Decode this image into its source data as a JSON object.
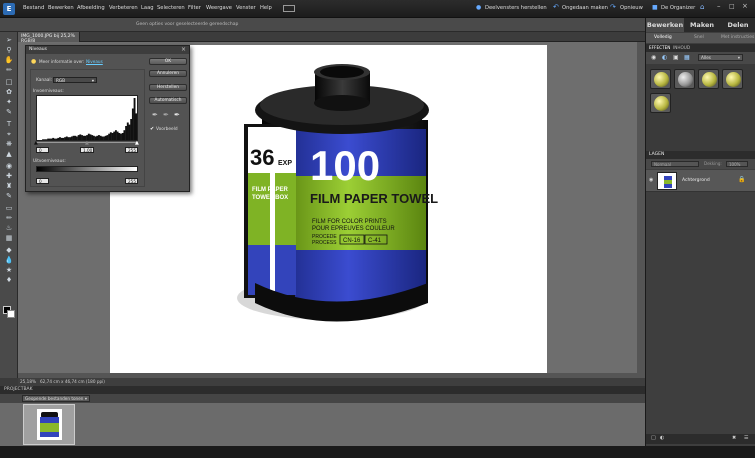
{
  "menubar": {
    "items": [
      "Bestand",
      "Bewerken",
      "Afbeelding",
      "Verbeteren",
      "Laag",
      "Selecteren",
      "Filter",
      "Weergave",
      "Venster",
      "Help"
    ],
    "undo_label": "Deelvensters herstellen",
    "create_label": "Ongedaan maken",
    "share_label": "Opnieuw",
    "organizer_label": "De Organizer"
  },
  "options_bar": {
    "hint": "Geen opties voor geselecteerde gereedschap"
  },
  "doc_tab": {
    "label": "IMG_1000.JPG bij 25,2% RGB/8"
  },
  "dialog": {
    "title": "Niveaus",
    "learn_more": "Meer informatie over:",
    "learn_link": "Niveaus",
    "channel_label": "Kanaal:",
    "channel_value": "RGB",
    "input_label": "Invoerniveaus:",
    "input_low": "0",
    "input_mid": "1,00",
    "input_high": "255",
    "output_label": "Uitvoerniveaus:",
    "output_low": "0",
    "output_high": "255",
    "ok": "OK",
    "cancel": "Annuleren",
    "reset": "Herstellen",
    "auto": "Automatisch",
    "preview": "Voorbeeld"
  },
  "status": {
    "zoom": "25,18%",
    "size": "62,74 cm x 46,74 cm (180 ppi)"
  },
  "project_bin": {
    "header": "PROJECTBAK",
    "dropdown": "Geopende bestanden tonen"
  },
  "right_panel": {
    "tabs": [
      "Bewerken",
      "Maken",
      "Delen"
    ],
    "subtabs": [
      "Volledig",
      "Snel",
      "Met instructies"
    ],
    "effects_tab": "EFFECTEN",
    "effects_tab2": "INHOUD",
    "effects_dropdown": "Alles",
    "layers_header": "LAGEN",
    "blend_mode": "Normaal",
    "opacity_label": "Dekking:",
    "opacity_value": "100%",
    "layer_name": "Achtergrond"
  },
  "histogram": [
    0,
    0,
    0,
    1,
    1,
    1,
    2,
    2,
    2,
    3,
    2,
    2,
    3,
    4,
    3,
    3,
    4,
    5,
    4,
    4,
    5,
    6,
    6,
    5,
    7,
    8,
    7,
    6,
    6,
    7,
    9,
    8,
    7,
    6,
    5,
    6,
    7,
    6,
    5,
    5,
    6,
    7,
    9,
    11,
    10,
    12,
    14,
    12,
    10,
    9,
    10,
    14,
    20,
    25,
    22,
    30,
    45,
    60,
    38
  ],
  "photo": {
    "big_number": "100",
    "exp_number": "36",
    "exp_suffix": "EXP",
    "brand": "FILM PAPER TOWEL",
    "side1": "FILM PAPER",
    "side2": "TOWEL BOX",
    "line1": "FILM FOR COLOR PRINTS",
    "line2": "POUR EPREUVES COULEUR",
    "line3": "PROCEDE",
    "line4": "PROCESS",
    "code1": "CN-16",
    "code2": "C-41"
  },
  "colors": {
    "blue": "#2f3fb8",
    "green": "#8ab82a",
    "accent": "#0c82d6"
  }
}
